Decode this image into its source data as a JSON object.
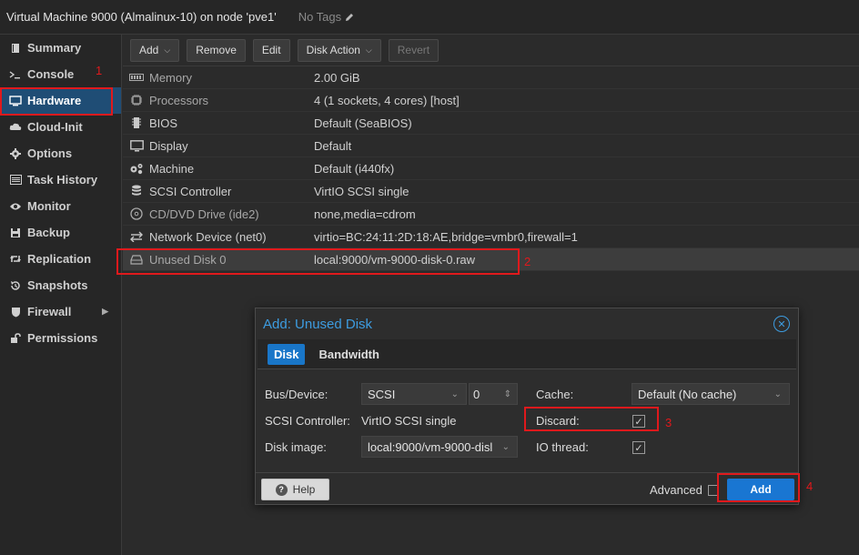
{
  "window": {
    "title": "Virtual Machine 9000 (Almalinux-10) on node 'pve1'",
    "tags_label": "No Tags"
  },
  "sidebar": {
    "items": [
      {
        "label": "Summary",
        "icon": "book-icon"
      },
      {
        "label": "Console",
        "icon": "terminal-icon"
      },
      {
        "label": "Hardware",
        "icon": "monitor-icon",
        "active": true
      },
      {
        "label": "Cloud-Init",
        "icon": "cloud-icon"
      },
      {
        "label": "Options",
        "icon": "gear-icon"
      },
      {
        "label": "Task History",
        "icon": "list-icon"
      },
      {
        "label": "Monitor",
        "icon": "eye-icon"
      },
      {
        "label": "Backup",
        "icon": "floppy-icon"
      },
      {
        "label": "Replication",
        "icon": "retweet-icon"
      },
      {
        "label": "Snapshots",
        "icon": "history-icon"
      },
      {
        "label": "Firewall",
        "icon": "shield-icon"
      },
      {
        "label": "Permissions",
        "icon": "unlock-icon"
      }
    ]
  },
  "toolbar": {
    "add": "Add",
    "remove": "Remove",
    "edit": "Edit",
    "disk_action": "Disk Action",
    "revert": "Revert"
  },
  "hardware": {
    "rows": [
      {
        "name": "Memory",
        "value": "2.00 GiB",
        "icon": "memory-icon"
      },
      {
        "name": "Processors",
        "value": "4 (1 sockets, 4 cores) [host]",
        "icon": "cpu-icon"
      },
      {
        "name": "BIOS",
        "value": "Default (SeaBIOS)",
        "icon": "chip-icon"
      },
      {
        "name": "Display",
        "value": "Default",
        "icon": "desktop-icon"
      },
      {
        "name": "Machine",
        "value": "Default (i440fx)",
        "icon": "cogs-icon"
      },
      {
        "name": "SCSI Controller",
        "value": "VirtIO SCSI single",
        "icon": "database-icon"
      },
      {
        "name": "CD/DVD Drive (ide2)",
        "value": "none,media=cdrom",
        "icon": "cdrom-icon"
      },
      {
        "name": "Network Device (net0)",
        "value": "virtio=BC:24:11:2D:18:AE,bridge=vmbr0,firewall=1",
        "icon": "exchange-icon"
      },
      {
        "name": "Unused Disk 0",
        "value": "local:9000/vm-9000-disk-0.raw",
        "icon": "hdd-icon"
      }
    ]
  },
  "dialog": {
    "title": "Add: Unused Disk",
    "tabs": [
      "Disk",
      "Bandwidth"
    ],
    "fields": {
      "bus_device_label": "Bus/Device:",
      "bus_value": "SCSI",
      "device_number": "0",
      "scsi_controller_label": "SCSI Controller:",
      "scsi_controller_value": "VirtIO SCSI single",
      "disk_image_label": "Disk image:",
      "disk_image_value": "local:9000/vm-9000-disl",
      "cache_label": "Cache:",
      "cache_value": "Default (No cache)",
      "discard_label": "Discard:",
      "discard_checked": true,
      "io_thread_label": "IO thread:",
      "io_thread_checked": true
    },
    "footer": {
      "help": "Help",
      "advanced": "Advanced",
      "advanced_checked": false,
      "add": "Add"
    }
  },
  "annotations": [
    "1",
    "2",
    "3",
    "4"
  ],
  "colors": {
    "accent": "#1976d2",
    "active_nav": "#1f4d75",
    "annotation_red": "#e0191c",
    "dialog_title": "#3d9ce0"
  }
}
